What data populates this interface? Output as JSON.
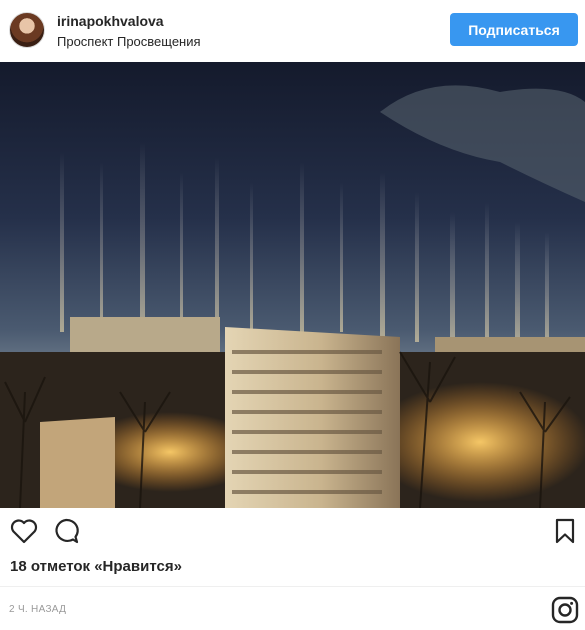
{
  "header": {
    "username": "irinapokhvalova",
    "location": "Проспект Просвещения",
    "follow_label": "Подписаться"
  },
  "post": {
    "image_icon": "photo-night-light-pillars",
    "likes": "18 отметок «Нравится»",
    "timestamp": "2 Ч. НАЗАД"
  },
  "icons": {
    "like": "heart-outline-icon",
    "comment": "speech-bubble-icon",
    "save": "bookmark-icon",
    "brand": "instagram-logo-icon"
  },
  "colors": {
    "accent": "#3897f0",
    "text": "#262626",
    "muted": "#999999"
  }
}
